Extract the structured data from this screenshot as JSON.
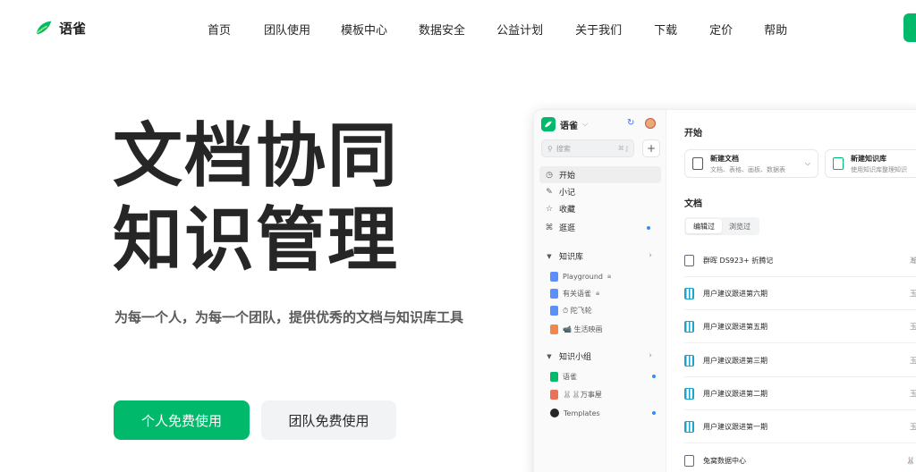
{
  "brand": {
    "name": "语雀",
    "color": "#00b96b"
  },
  "nav": {
    "items": [
      "首页",
      "团队使用",
      "模板中心",
      "数据安全",
      "公益计划",
      "关于我们",
      "下载",
      "定价",
      "帮助"
    ]
  },
  "hero": {
    "title_line1": "文档协同",
    "title_line2": "知识管理",
    "subtitle": "为每一个人，为每一个团队，提供优秀的文档与知识库工具",
    "primary_cta": "个人免费使用",
    "secondary_cta": "团队免费使用"
  },
  "app": {
    "sidebar": {
      "title": "语雀",
      "search_placeholder": "搜索",
      "search_shortcut": "⌘ J",
      "items": [
        {
          "label": "开始",
          "icon": "clock-icon"
        },
        {
          "label": "小记",
          "icon": "pen-icon"
        },
        {
          "label": "收藏",
          "icon": "star-icon"
        },
        {
          "label": "逛逛",
          "icon": "grid-icon"
        }
      ],
      "knowledge_section": "知识库",
      "books": [
        {
          "label": "Playground",
          "icon": "book-icon"
        },
        {
          "label": "有关语雀",
          "icon": "book-icon"
        },
        {
          "label": "⏱ 陀飞轮",
          "icon": "book-icon"
        },
        {
          "label": "📹 生活映画",
          "icon": "photo-icon"
        }
      ],
      "group_section": "知识小组",
      "groups": [
        {
          "label": "语雀",
          "icon": "yuque-group-icon"
        },
        {
          "label": "🐰🐰万事屋",
          "icon": "emoji-group-icon"
        },
        {
          "label": "Templates",
          "icon": "github-icon"
        }
      ]
    },
    "main": {
      "start_heading": "开始",
      "new_doc": {
        "title": "新建文档",
        "desc": "文档、表格、画板、数据表"
      },
      "new_book": {
        "title": "新建知识库",
        "desc": "使用知识库整理知识"
      },
      "docs_heading": "文档",
      "tabs": [
        "编辑过",
        "浏览过"
      ],
      "docs": [
        {
          "title": "群晖 DS923+ 折腾记",
          "author": "瀚德",
          "icon": "doc"
        },
        {
          "title": "用户建议跟进第六期",
          "author": "玉伯",
          "icon": "board"
        },
        {
          "title": "用户建议跟进第五期",
          "author": "玉伯",
          "icon": "board"
        },
        {
          "title": "用户建议跟进第三期",
          "author": "玉伯",
          "icon": "board"
        },
        {
          "title": "用户建议跟进第二期",
          "author": "玉伯",
          "icon": "board"
        },
        {
          "title": "用户建议跟进第一期",
          "author": "玉伯",
          "icon": "board"
        },
        {
          "title": "兔窝数据中心",
          "author": "🐰🐰",
          "icon": "doc"
        }
      ]
    }
  }
}
